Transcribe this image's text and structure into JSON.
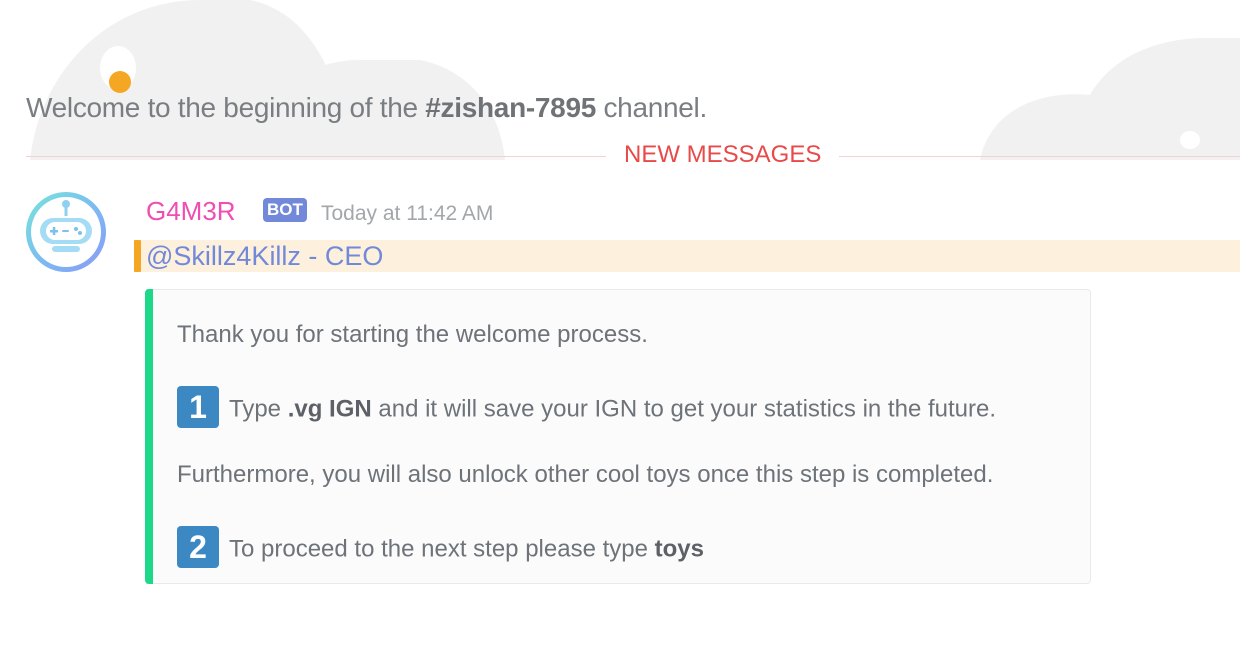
{
  "welcome": {
    "prefix": "Welcome to the beginning of the",
    "channel": "#zishan-7895",
    "suffix": "channel."
  },
  "divider": {
    "label": "NEW MESSAGES"
  },
  "message": {
    "username": "G4M3R",
    "tag": "BOT",
    "timestamp": "Today at 11:42 AM",
    "mention": "@Skillz4Killz - CEO",
    "embed": {
      "intro": "Thank you for starting the welcome process.",
      "step1": {
        "badge": "1",
        "pre": "Type",
        "command": ".vg IGN",
        "post": "and it will save your IGN to get your statistics in the future."
      },
      "note": "Furthermore, you will also unlock other cool toys once this step is completed.",
      "step2": {
        "badge": "2",
        "pre": "To proceed to the next step please type",
        "command": "toys"
      }
    }
  },
  "colors": {
    "username": "#f04eb0",
    "bot_tag": "#7289da",
    "new_messages": "#e84a4a",
    "embed_accent": "#1ed88a",
    "mention_bar": "#f5a623",
    "keycap": "#3b88c3"
  }
}
